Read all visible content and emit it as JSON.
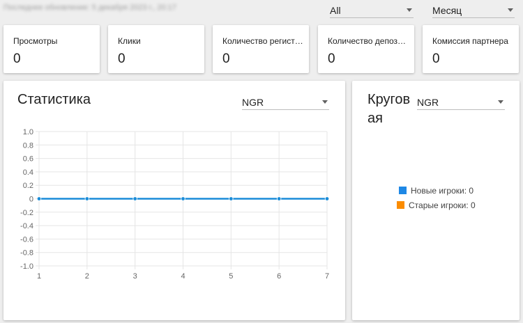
{
  "header": {
    "last_updated": "Последнее обновление: 5 декабря 2023 г., 20:17",
    "filter_select": {
      "value": "All"
    },
    "period_select": {
      "value": "Месяц"
    }
  },
  "stats": [
    {
      "label": "Просмотры",
      "value": "0"
    },
    {
      "label": "Клики",
      "value": "0"
    },
    {
      "label": "Количество регистраций",
      "value": "0"
    },
    {
      "label": "Количество депозитов",
      "value": "0"
    },
    {
      "label": "Комиссия партнера",
      "value": "0"
    }
  ],
  "statistics_panel": {
    "title": "Статистика",
    "metric_select": {
      "value": "NGR"
    }
  },
  "pie_panel": {
    "title_line1": "Кругов",
    "title_line2": "ая",
    "metric_select": {
      "value": "NGR"
    },
    "legend": [
      {
        "label": "Новые игроки: 0",
        "color": "#1e88e5"
      },
      {
        "label": "Старые игроки: 0",
        "color": "#fb8c00"
      }
    ]
  },
  "chart_data": {
    "type": "line",
    "x": [
      1,
      2,
      3,
      4,
      5,
      6,
      7
    ],
    "series": [
      {
        "values": [
          0,
          0,
          0,
          0,
          0,
          0,
          0
        ],
        "color": "#1a8cd8"
      }
    ],
    "ylim": [
      -1.0,
      1.0
    ],
    "yticks": [
      "1.0",
      "0.8",
      "0.6",
      "0.4",
      "0.2",
      "0",
      "-0.2",
      "-0.4",
      "-0.6",
      "-0.8",
      "-1.0"
    ],
    "xticks": [
      "1",
      "2",
      "3",
      "4",
      "5",
      "6",
      "7"
    ],
    "grid": true
  }
}
